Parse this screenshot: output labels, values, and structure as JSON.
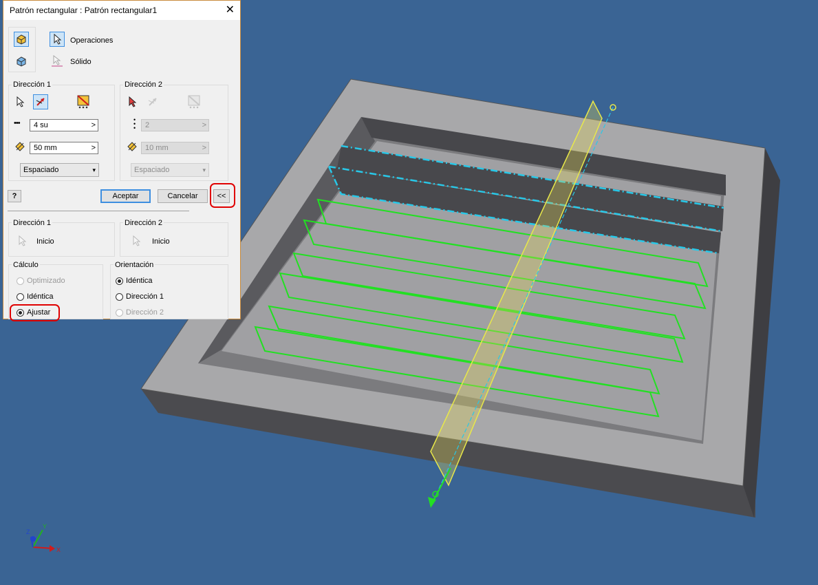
{
  "dialog": {
    "title": "Patrón rectangular : Patrón rectangular1",
    "close_glyph": "✕",
    "operaciones_label": "Operaciones",
    "solido_label": "Sólido",
    "direction1": {
      "label": "Dirección 1",
      "count": "4 su",
      "distance": "50 mm",
      "method": "Espaciado"
    },
    "direction2": {
      "label": "Dirección 2",
      "count": "2",
      "distance": "10 mm",
      "method": "Espaciado"
    },
    "help_glyph": "?",
    "accept_label": "Aceptar",
    "cancel_label": "Cancelar",
    "collapse_label": "<<",
    "start1": {
      "group_label": "Dirección 1",
      "value": "Inicio"
    },
    "start2": {
      "group_label": "Dirección 2",
      "value": "Inicio"
    },
    "calculo": {
      "label": "Cálculo",
      "options": [
        "Optimizado",
        "Idéntica",
        "Ajustar"
      ],
      "selected": "Ajustar"
    },
    "orientacion": {
      "label": "Orientación",
      "options": [
        "Idéntica",
        "Dirección 1",
        "Dirección 2"
      ],
      "selected": "Idéntica"
    },
    "highlight_color": "#e00000"
  },
  "viewport": {
    "background": "#3a6494",
    "part_top_color": "#a9a9ab",
    "part_side_color": "#4a4a4e",
    "preview_color": "#22e022",
    "direction_axis_color": "#e8e84a",
    "selection_color": "#28c8e8",
    "axis_labels": {
      "x": "X",
      "y": "Y",
      "z": "Z"
    }
  }
}
